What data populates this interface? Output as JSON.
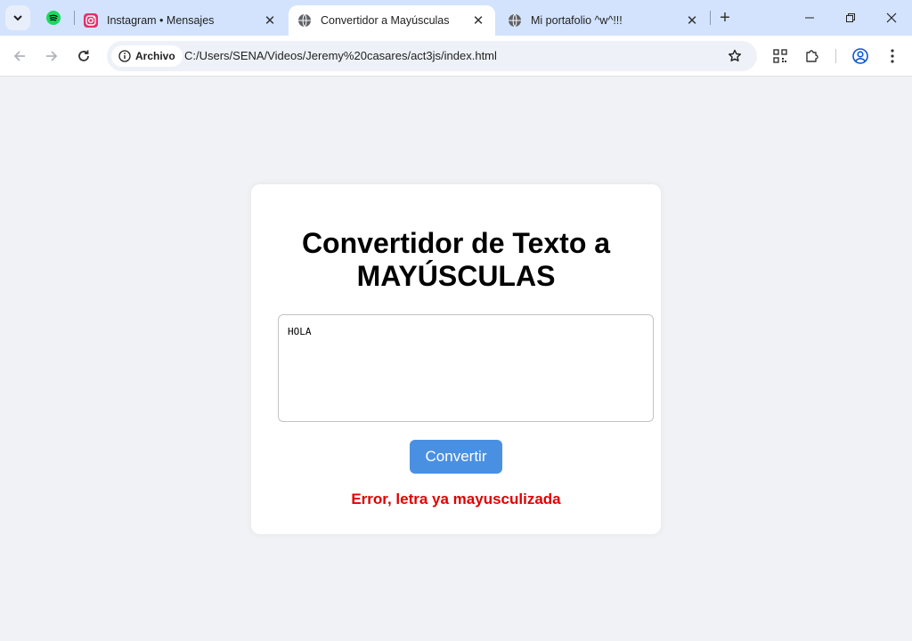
{
  "browser": {
    "tabs": [
      {
        "title": "Instagram • Mensajes",
        "active": false
      },
      {
        "title": "Convertidor a Mayúsculas",
        "active": true
      },
      {
        "title": "Mi portafolio ^w^!!!",
        "active": false
      }
    ],
    "address": {
      "security_chip": "Archivo",
      "url": "C:/Users/SENA/Videos/Jeremy%20casares/act3js/index.html"
    }
  },
  "page": {
    "title_line1": "Convertidor de Texto a",
    "title_line2": "MAYÚSCULAS",
    "input_value": "HOLA",
    "button_label": "Convertir",
    "error_message": "Error, letra ya mayusculizada"
  },
  "colors": {
    "accent": "#4a90e2",
    "error": "#e00000",
    "page_bg": "#f0f2f5",
    "tabstrip_bg": "#d3e3fd"
  }
}
